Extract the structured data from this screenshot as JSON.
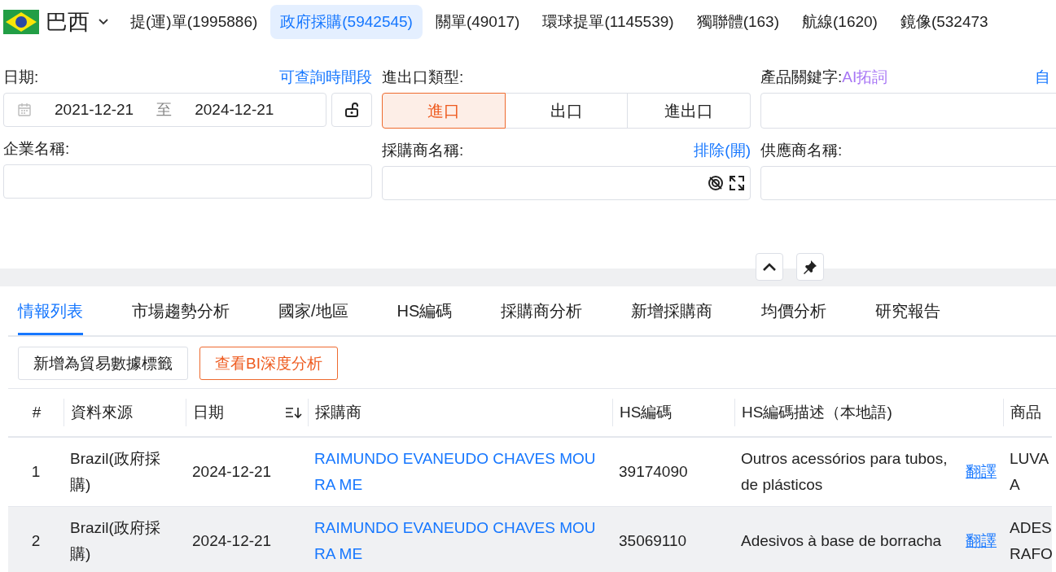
{
  "country": {
    "name": "巴西"
  },
  "source_tabs": [
    {
      "label": "提(運)單(1995886)",
      "selected": false
    },
    {
      "label": "政府採購(5942545)",
      "selected": true
    },
    {
      "label": "關單(49017)",
      "selected": false
    },
    {
      "label": "環球提單(1145539)",
      "selected": false
    },
    {
      "label": "獨聯體(163)",
      "selected": false
    },
    {
      "label": "航線(1620)",
      "selected": false
    },
    {
      "label": "鏡像(532473",
      "selected": false
    }
  ],
  "filters": {
    "date": {
      "label": "日期:",
      "link": "可查詢時間段",
      "from": "2021-12-21",
      "separator": "至",
      "to": "2024-12-21"
    },
    "trade_type": {
      "label": "進出口類型:",
      "options": [
        {
          "label": "進口",
          "selected": true
        },
        {
          "label": "出口",
          "selected": false
        },
        {
          "label": "進出口",
          "selected": false
        }
      ]
    },
    "keyword": {
      "label": "產品關鍵字:",
      "ai_link": "AI拓詞",
      "right_link": "自"
    },
    "company": {
      "label": "企業名稱:"
    },
    "buyer": {
      "label": "採購商名稱:",
      "link": "排除(開)"
    },
    "supplier": {
      "label": "供應商名稱:"
    }
  },
  "analysis_tabs": [
    {
      "label": "情報列表",
      "selected": true
    },
    {
      "label": "市場趨勢分析",
      "selected": false
    },
    {
      "label": "國家/地區",
      "selected": false
    },
    {
      "label": "HS編碼",
      "selected": false
    },
    {
      "label": "採購商分析",
      "selected": false
    },
    {
      "label": "新增採購商",
      "selected": false
    },
    {
      "label": "均價分析",
      "selected": false
    },
    {
      "label": "研究報告",
      "selected": false
    }
  ],
  "actions": [
    {
      "label": "新增為貿易數據標籤",
      "kind": "default"
    },
    {
      "label": "查看BI深度分析",
      "kind": "accent"
    }
  ],
  "table": {
    "columns": [
      "#",
      "資料來源",
      "日期",
      "採購商",
      "HS編碼",
      "HS編碼描述（本地語)",
      "商品"
    ],
    "rows": [
      {
        "index": "1",
        "source": "Brazil(政府採購)",
        "date": "2024-12-21",
        "buyer": "RAIMUNDO EVANEUDO CHAVES MOURA ME",
        "hs_code": "39174090",
        "hs_desc": "Outros acessórios para tubos, de plásticos",
        "translate": "翻譯",
        "product": "LUVA A",
        "highlighted": false
      },
      {
        "index": "2",
        "source": "Brazil(政府採購)",
        "date": "2024-12-21",
        "buyer": "RAIMUNDO EVANEUDO CHAVES MOURA ME",
        "hs_code": "35069110",
        "hs_desc": "Adesivos à base de borracha",
        "translate": "翻譯",
        "product": "ADES RAFO",
        "highlighted": true
      }
    ]
  }
}
